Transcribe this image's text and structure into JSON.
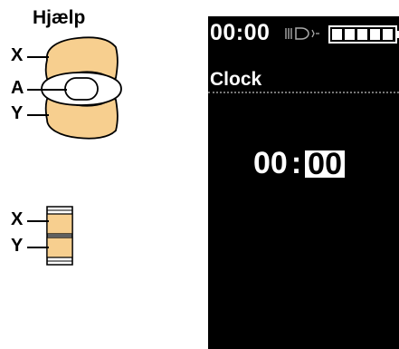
{
  "help": {
    "title": "Hjælp",
    "labels": {
      "x": "X",
      "a": "A",
      "y": "Y"
    }
  },
  "remote": {
    "labels": {
      "x": "X",
      "y": "Y"
    }
  },
  "display": {
    "status_time": "00:00",
    "light_icon": "headlight-icon",
    "battery_icon": "battery-icon",
    "battery_level": 1.0,
    "screen_title": "Clock",
    "clock": {
      "hours": "00",
      "separator": ":",
      "minutes": "00"
    }
  },
  "colors": {
    "button_fill": "#f7cf8f",
    "outline": "#000000",
    "display_bg": "#000000",
    "display_text": "#ffffff"
  }
}
